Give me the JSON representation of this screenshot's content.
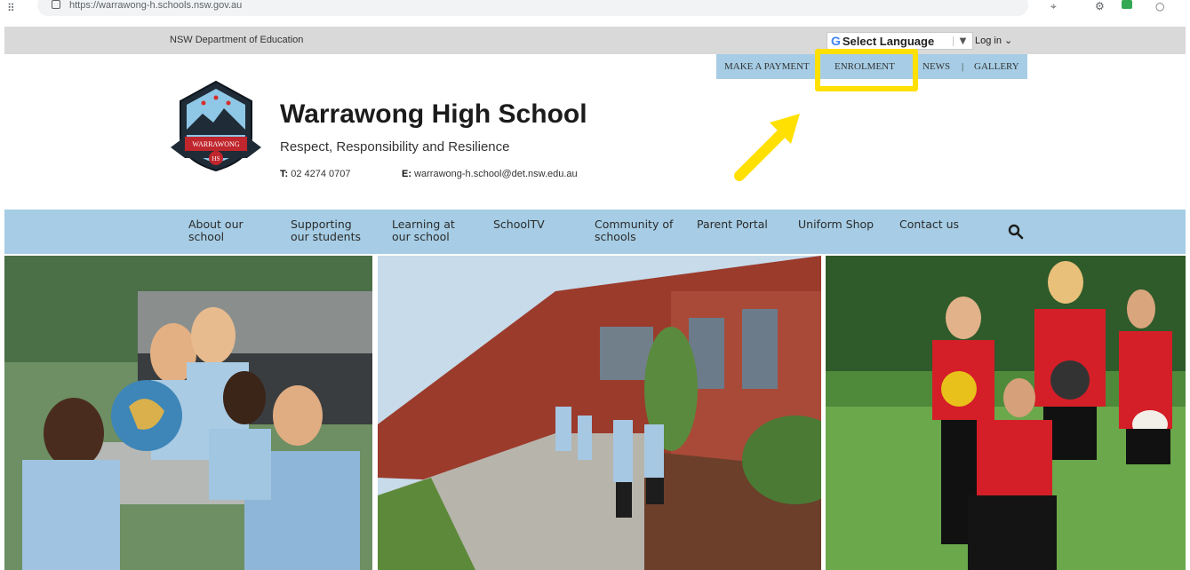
{
  "browser": {
    "url": "https://warrawong-h.schools.nsw.gov.au"
  },
  "topbar": {
    "department": "NSW Department of Education",
    "language_g": "G",
    "language_label": "Select Language",
    "language_arrow": "▼",
    "login": "Log in ⌄"
  },
  "quick_links": [
    {
      "label": "MAKE A PAYMENT"
    },
    {
      "label": "ENROLMENT"
    },
    {
      "label": "NEWS"
    },
    {
      "label": "GALLERY"
    }
  ],
  "quick_links_separator": "|",
  "header": {
    "school_name": "Warrawong High School",
    "motto": "Respect, Responsibility and Resilience",
    "phone_label": "T:",
    "phone": "02 4274 0707",
    "email_label": "E:",
    "email": "warrawong-h.school@det.nsw.edu.au",
    "logo_text_top": "WARRAWONG",
    "logo_text_bottom": "HS"
  },
  "nav": {
    "items": [
      {
        "line1": "About our",
        "line2": "school"
      },
      {
        "line1": "Supporting",
        "line2": "our students"
      },
      {
        "line1": "Learning at",
        "line2": "our school"
      },
      {
        "line1": "SchoolTV",
        "line2": ""
      },
      {
        "line1": "Community of",
        "line2": "schools"
      },
      {
        "line1": "Parent Portal",
        "line2": ""
      },
      {
        "line1": "Uniform Shop",
        "line2": ""
      },
      {
        "line1": "Contact us",
        "line2": ""
      }
    ]
  },
  "colors": {
    "nav_bg": "#a6cde5",
    "topbar_bg": "#d9d9d9",
    "annotation": "#ffe000"
  }
}
